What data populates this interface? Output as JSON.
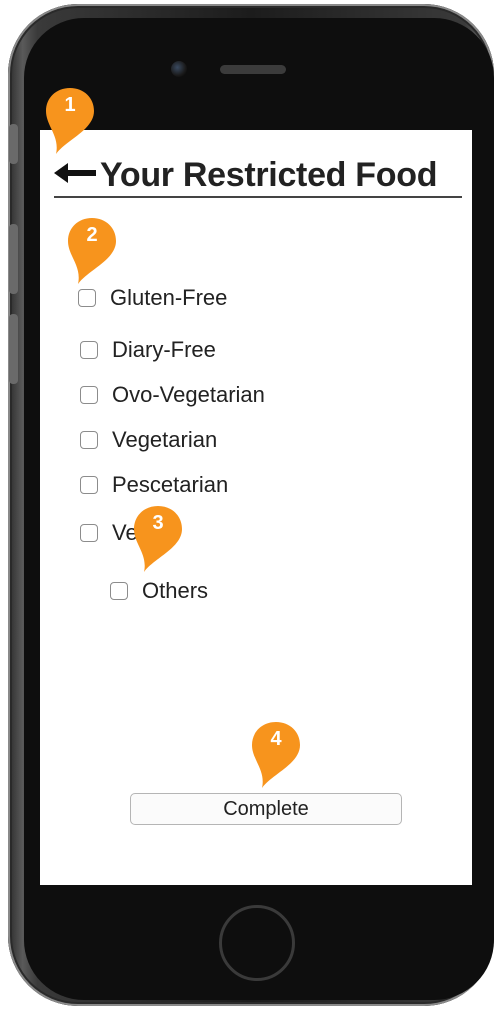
{
  "header": {
    "back_icon": "back-arrow-icon",
    "title": "Your Restricted Food"
  },
  "options": [
    {
      "label": "Gluten-Free",
      "checked": false
    },
    {
      "label": "Diary-Free",
      "checked": false
    },
    {
      "label": "Ovo-Vegetarian",
      "checked": false
    },
    {
      "label": "Vegetarian",
      "checked": false
    },
    {
      "label": "Pescetarian",
      "checked": false
    },
    {
      "label": "Vegan",
      "checked": false
    },
    {
      "label": "Others",
      "checked": false
    }
  ],
  "footer": {
    "complete_label": "Complete"
  },
  "callouts": [
    {
      "number": "1"
    },
    {
      "number": "2"
    },
    {
      "number": "3"
    },
    {
      "number": "4"
    }
  ],
  "colors": {
    "callout": "#f7941d",
    "screen_bg": "#ffffff",
    "phone_body": "#1c1c1c"
  }
}
